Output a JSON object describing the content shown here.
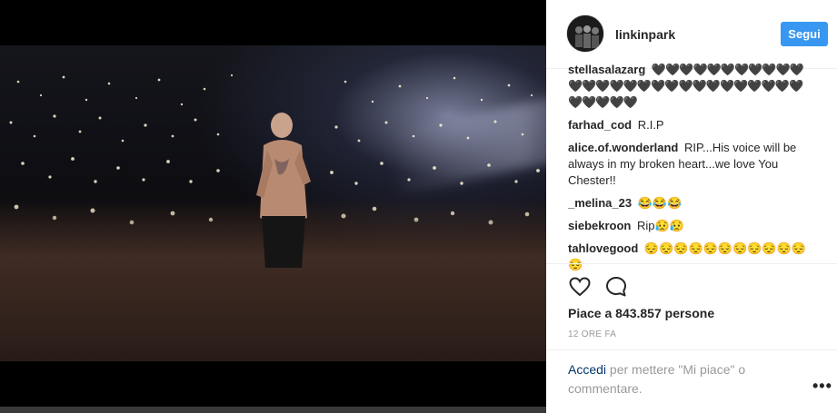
{
  "post": {
    "username": "linkinpark",
    "follow_label": "Segui",
    "likes_text": "Piace a 843.857 persone",
    "time_text": "12 ORE FA",
    "login_link": "Accedi",
    "login_rest": " per mettere \"Mi piace\" o commentare."
  },
  "comments": [
    {
      "author": "stellasalazarg",
      "text": "🖤🖤🖤🖤🖤🖤🖤🖤🖤🖤🖤🖤🖤🖤🖤🖤🖤🖤🖤🖤🖤🖤🖤🖤🖤🖤🖤🖤🖤🖤🖤🖤🖤"
    },
    {
      "author": "farhad_cod",
      "text": "R.I.P"
    },
    {
      "author": "alice.of.wonderland",
      "text": "RIP...His voice will be always in my broken heart...we love You Chester!!"
    },
    {
      "author": "_melina_23",
      "text": "😂😂😂"
    },
    {
      "author": "siebekroon",
      "text": "Rip😥😥"
    },
    {
      "author": "tahlovegood",
      "text": "😔😔😔😔😔😔😔😔😔😔😔😔"
    }
  ],
  "icons": {
    "like": "heart-outline-icon",
    "comment": "comment-bubble-icon",
    "more": "more-horizontal-icon"
  },
  "colors": {
    "follow_button": "#3897f0",
    "link": "#003569"
  }
}
